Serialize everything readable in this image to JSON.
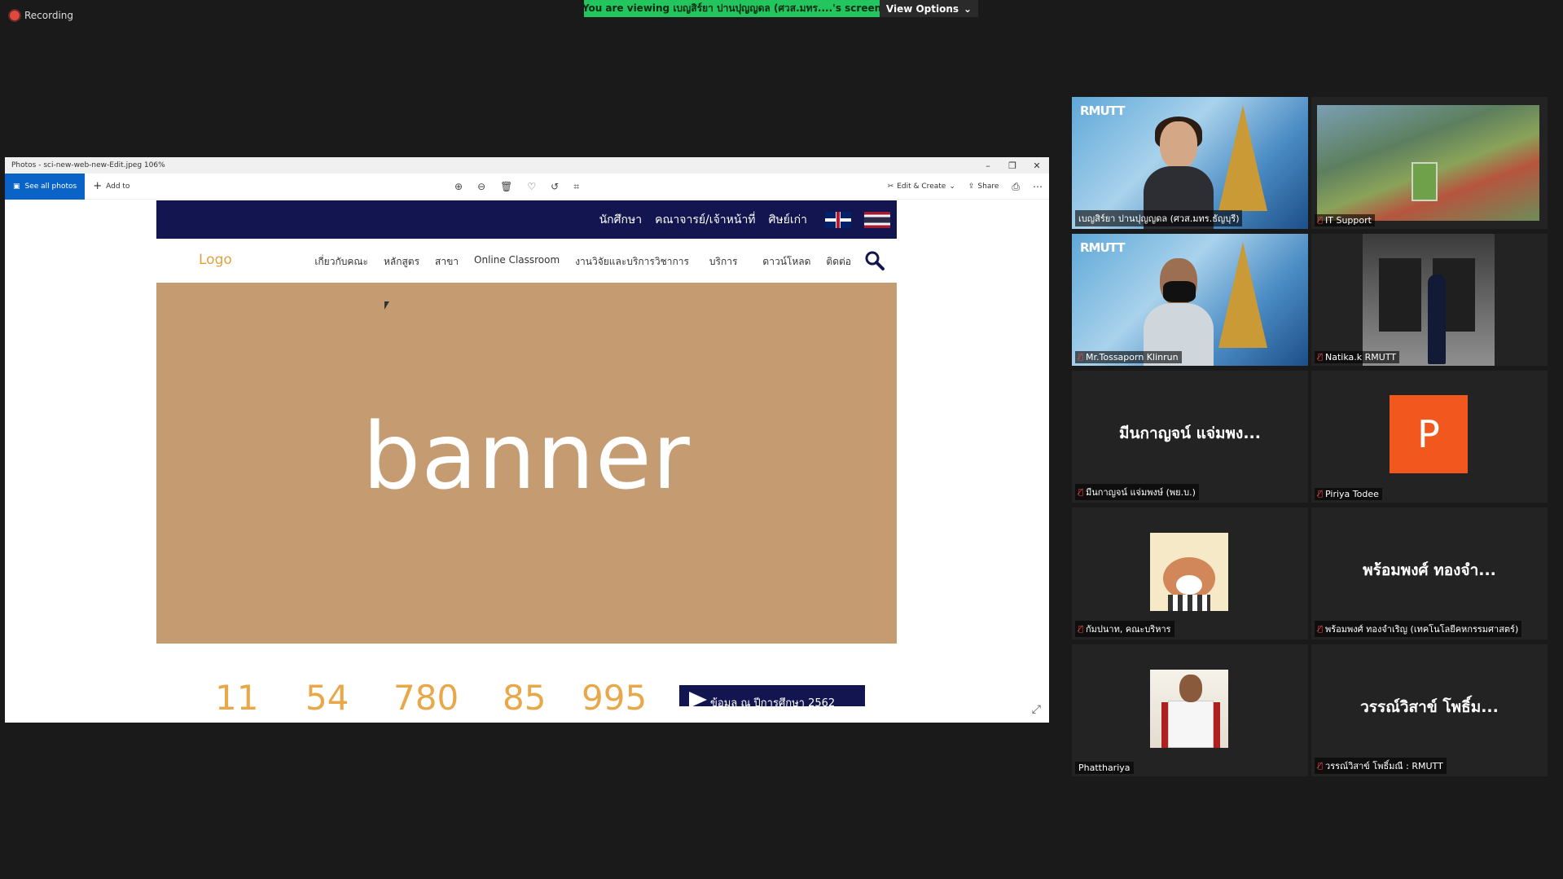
{
  "zoom": {
    "recording_label": "Recording",
    "viewing_banner": "You are viewing เบญสิร์ยา ปานปุญญดล (ศวส.มทร....'s screen",
    "view_options_label": "View Options"
  },
  "photos_window": {
    "title": "Photos - sci-new-web-new-Edit.jpeg   106%",
    "toolbar": {
      "see_all_photos": "See all photos",
      "add_to": "Add to",
      "edit_create": "Edit & Create",
      "share": "Share"
    }
  },
  "website": {
    "top_links": [
      "นักศึกษา",
      "คณาจารย์/เจ้าหน้าที่",
      "ศิษย์เก่า"
    ],
    "logo_text": "Logo",
    "nav_links": [
      "เกี่ยวกับคณะ",
      "หลักสูตร",
      "สาขา",
      "Online Classroom",
      "งานวิจัยและบริการวิชาการ",
      "บริการ",
      "ดาวน์โหลด",
      "ติดต่อ"
    ],
    "banner_text": "banner",
    "stats": [
      "11",
      "54",
      "780",
      "85",
      "995"
    ],
    "stats_cta": "ข้อมูล ณ ปีการศึกษา 2562"
  },
  "participants": [
    {
      "name": "เบญสิร์ยา ปานปุญญดล (ศวส.มทร.ธัญบุรี)",
      "muted": false,
      "active": true
    },
    {
      "name": "IT Support",
      "muted": true,
      "active": false
    },
    {
      "name": "Mr.Tossaporn Klinrun",
      "muted": true,
      "active": false
    },
    {
      "name": "Natika.k RMUTT",
      "muted": true,
      "active": false
    },
    {
      "name": "มีนกาญจน์ แจ่มพงษ์ (พย.บ.)",
      "display_name": "มีนกาญจน์ แจ่มพง...",
      "muted": true,
      "active": false
    },
    {
      "name": "Piriya Todee",
      "initial": "P",
      "muted": true,
      "active": false
    },
    {
      "name": "กัมปนาท, คณะบริหาร",
      "muted": true,
      "active": false
    },
    {
      "name": "พร้อมพงศ์ ทองจำเริญ (เทคโนโลยีคหกรรมศาสตร์)",
      "display_name": "พร้อมพงศ์ ทองจำ...",
      "muted": true,
      "active": false
    },
    {
      "name": "Phatthariya",
      "muted": false,
      "active": false
    },
    {
      "name": "วรรณ์วิสาข์ โพธิ์มณี : RMUTT",
      "display_name": "วรรณ์วิสาข์ โพธิ์ม...",
      "muted": true,
      "active": false
    }
  ],
  "logos": {
    "rmutt": "RMUTT"
  }
}
